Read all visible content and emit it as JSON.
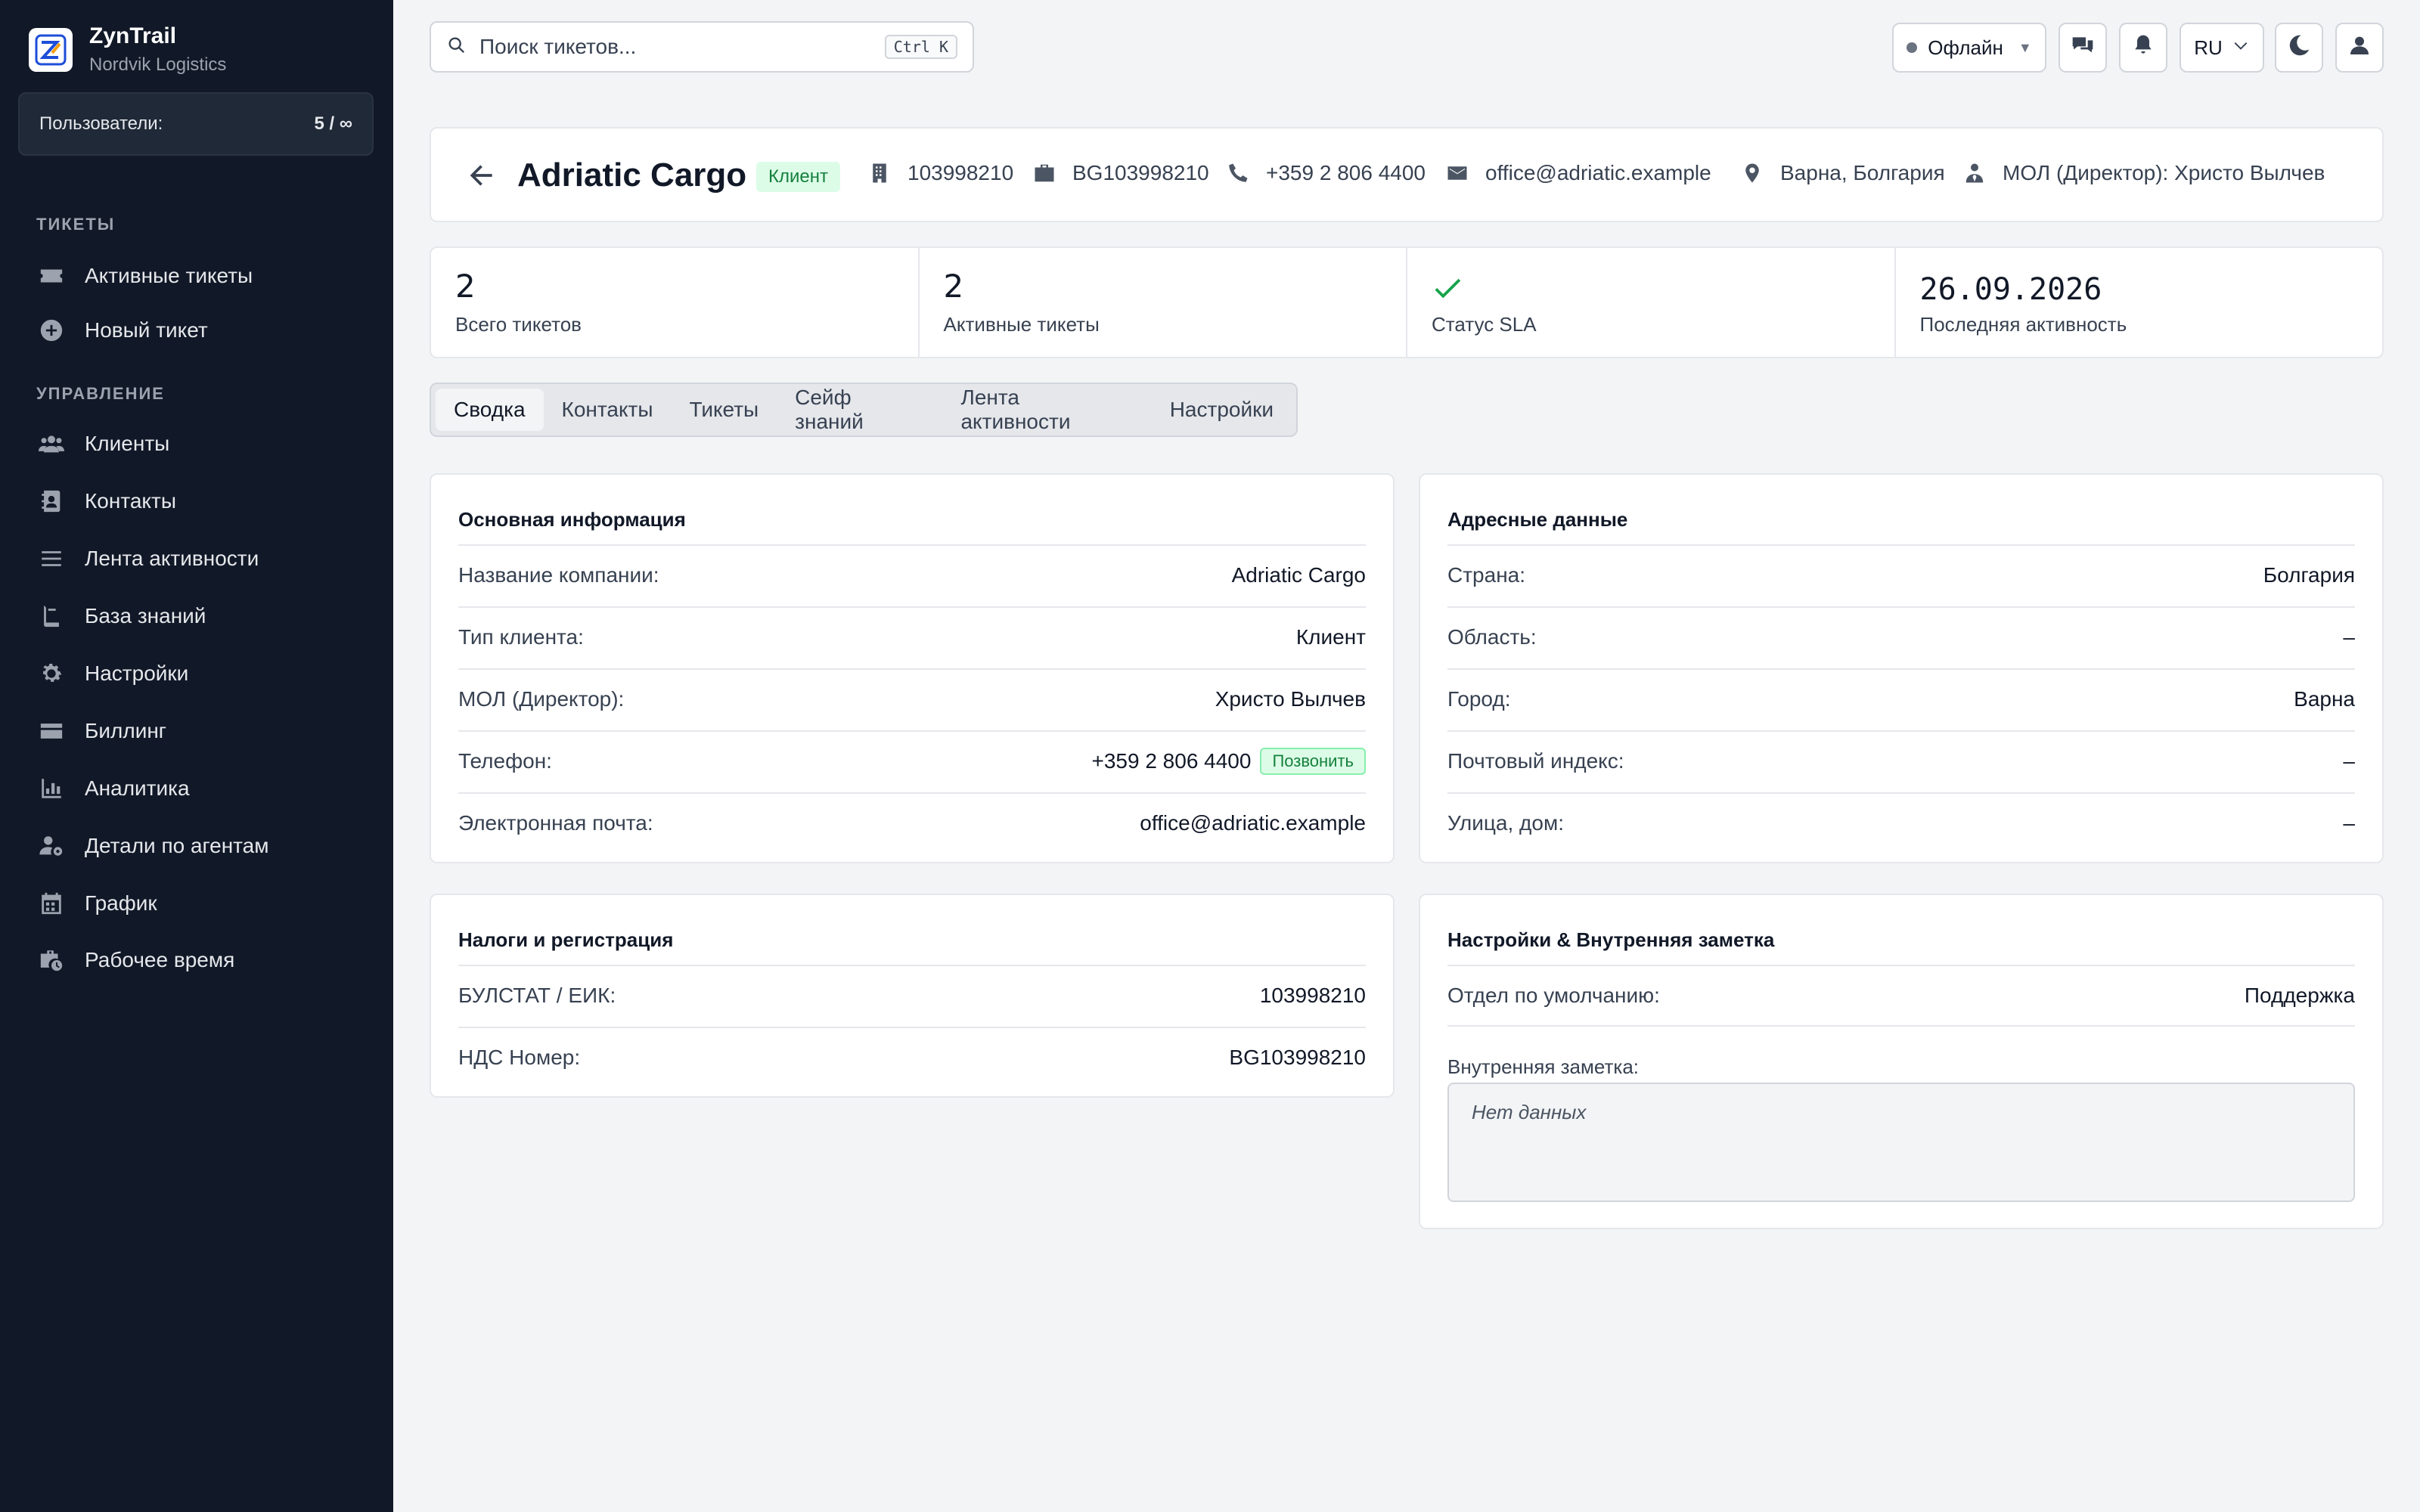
{
  "app": {
    "title": "ZynTrail",
    "org": "Nordvik Logistics"
  },
  "sidebar": {
    "users_label": "Пользователи:",
    "users_value": "5 / ∞",
    "sections": [
      {
        "title": "ТИКЕТЫ",
        "items": [
          {
            "label": "Активные тикеты",
            "icon": "ticket-icon"
          },
          {
            "label": "Новый тикет",
            "icon": "plus-circle-icon"
          }
        ]
      },
      {
        "title": "УПРАВЛЕНИЕ",
        "items": [
          {
            "label": "Клиенты",
            "icon": "users-icon"
          },
          {
            "label": "Контакты",
            "icon": "contact-book-icon"
          },
          {
            "label": "Лента активности",
            "icon": "list-icon"
          },
          {
            "label": "База знаний",
            "icon": "book-icon"
          },
          {
            "label": "Настройки",
            "icon": "gear-icon"
          },
          {
            "label": "Биллинг",
            "icon": "credit-card-icon"
          },
          {
            "label": "Аналитика",
            "icon": "chart-icon"
          },
          {
            "label": "Детали по агентам",
            "icon": "user-gear-icon"
          },
          {
            "label": "График",
            "icon": "calendar-icon"
          },
          {
            "label": "Рабочее время",
            "icon": "briefcase-clock-icon"
          }
        ]
      }
    ]
  },
  "topbar": {
    "search_placeholder": "Поиск тикетов...",
    "search_shortcut": "Ctrl K",
    "status_label": "Офлайн",
    "language": "RU"
  },
  "client": {
    "name": "Adriatic Cargo",
    "type_badge": "Клиент",
    "bulstat": "103998210",
    "vat": "BG103998210",
    "phone": "+359 2 806 4400",
    "email": "office@adriatic.example",
    "location": "Варна, Болгария",
    "manager": "МОЛ (Директор): Христо Вылчев"
  },
  "stats": {
    "total_tickets_value": "2",
    "total_tickets_label": "Всего тикетов",
    "active_tickets_value": "2",
    "active_tickets_label": "Активные тикеты",
    "sla_label": "Статус SLA",
    "last_activity_value": "26.09.2026",
    "last_activity_label": "Последняя активность"
  },
  "tabs": [
    "Сводка",
    "Контакты",
    "Тикеты",
    "Сейф знаний",
    "Лента активности",
    "Настройки"
  ],
  "basic_info": {
    "title": "Основная информация",
    "rows": [
      {
        "label": "Название компании:",
        "value": "Adriatic Cargo"
      },
      {
        "label": "Тип клиента:",
        "value": "Клиент"
      },
      {
        "label": "МОЛ (Директор):",
        "value": "Христо Вылчев"
      },
      {
        "label": "Телефон:",
        "value": "+359 2 806 4400"
      },
      {
        "label": "Электронная почта:",
        "value": "office@adriatic.example"
      }
    ],
    "call_label": "Позвонить"
  },
  "address": {
    "title": "Адресные данные",
    "rows": [
      {
        "label": "Страна:",
        "value": "Болгария"
      },
      {
        "label": "Область:",
        "value": "–"
      },
      {
        "label": "Город:",
        "value": "Варна"
      },
      {
        "label": "Почтовый индекс:",
        "value": "–"
      },
      {
        "label": "Улица, дом:",
        "value": "–"
      }
    ]
  },
  "taxes": {
    "title": "Налоги и регистрация",
    "rows": [
      {
        "label": "БУЛСТАТ / ЕИК:",
        "value": "103998210"
      },
      {
        "label": "НДС Номер:",
        "value": "BG103998210"
      }
    ]
  },
  "settings_note": {
    "title": "Настройки & Внутренняя заметка",
    "rows": [
      {
        "label": "Отдел по умолчанию:",
        "value": "Поддержка"
      }
    ],
    "note_label": "Внутренняя заметка:",
    "note_value": "Нет данных"
  },
  "colors": {
    "sidebar_bg": "#111827",
    "accent_green": "#16a34a",
    "badge_green_bg": "#dcfce7"
  }
}
